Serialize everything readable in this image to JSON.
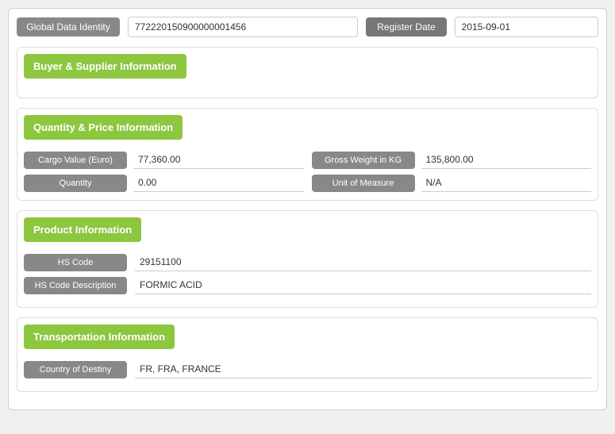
{
  "header": {
    "global_data_identity_label": "Global Data Identity",
    "global_data_identity_value": "772220150900000001456",
    "register_date_label": "Register Date",
    "register_date_value": "2015-09-01"
  },
  "buyer_supplier": {
    "title": "Buyer & Supplier Information"
  },
  "quantity_price": {
    "title": "Quantity & Price Information",
    "cargo_value_label": "Cargo Value (Euro)",
    "cargo_value_value": "77,360.00",
    "gross_weight_label": "Gross Weight in KG",
    "gross_weight_value": "135,800.00",
    "quantity_label": "Quantity",
    "quantity_value": "0.00",
    "unit_of_measure_label": "Unit of Measure",
    "unit_of_measure_value": "N/A"
  },
  "product_info": {
    "title": "Product Information",
    "hs_code_label": "HS Code",
    "hs_code_value": "29151100",
    "hs_code_desc_label": "HS Code Description",
    "hs_code_desc_value": "FORMIC ACID"
  },
  "transportation": {
    "title": "Transportation Information",
    "country_destiny_label": "Country of Destiny",
    "country_destiny_value": "FR, FRA, FRANCE"
  }
}
